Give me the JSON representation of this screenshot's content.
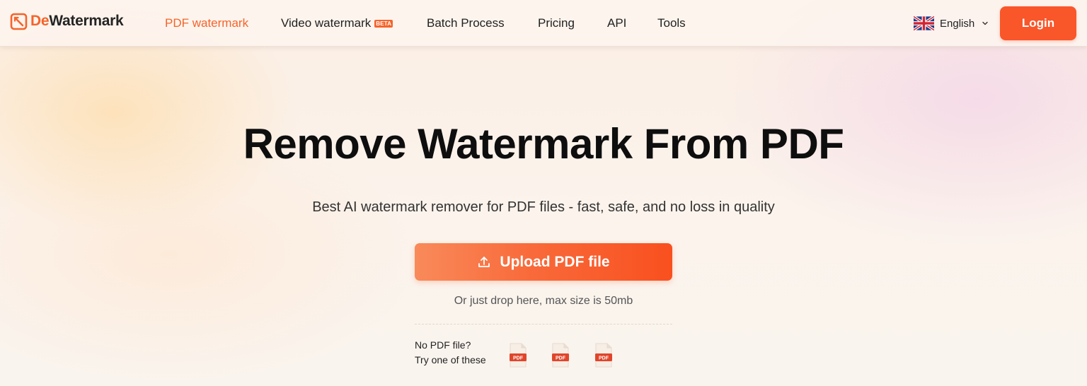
{
  "brand": {
    "name_part1": "De",
    "name_part2": "Watermark",
    "accent_color": "#f4642b"
  },
  "nav": {
    "items": [
      {
        "label": "PDF watermark",
        "active": true
      },
      {
        "label": "Video watermark",
        "badge": "BETA"
      },
      {
        "label": "Batch Process"
      },
      {
        "label": "Pricing"
      },
      {
        "label": "API"
      },
      {
        "label": "Tools"
      }
    ]
  },
  "language": {
    "label": "English",
    "flag_icon": "uk-flag-icon"
  },
  "header": {
    "login_label": "Login"
  },
  "hero": {
    "title": "Remove Watermark From PDF",
    "subtitle": "Best AI watermark remover for PDF files - fast, safe, and no loss in quality",
    "upload_label": "Upload PDF file",
    "upload_icon": "upload-icon",
    "drop_hint": "Or just drop here, max size is 50mb"
  },
  "samples": {
    "prompt_line1": "No PDF file?",
    "prompt_line2": "Try one of these",
    "file_label": "PDF",
    "items": [
      {
        "label": "PDF"
      },
      {
        "label": "PDF"
      },
      {
        "label": "PDF"
      }
    ]
  },
  "colors": {
    "cta_gradient_start": "#f98a5a",
    "cta_gradient_end": "#f9501f",
    "login_bg": "#f9562a"
  }
}
